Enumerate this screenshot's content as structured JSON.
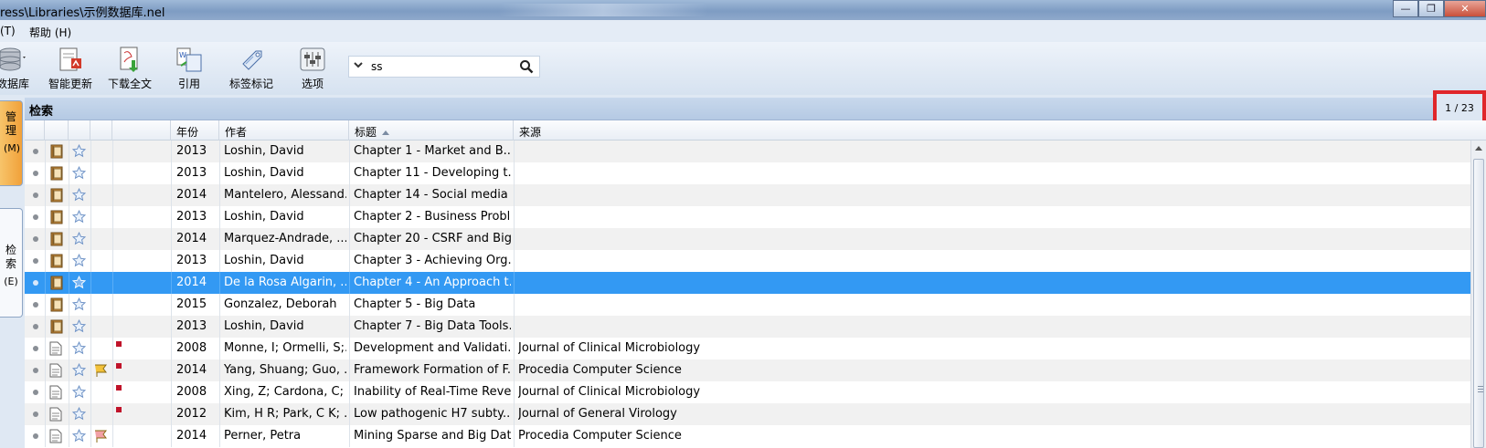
{
  "window": {
    "title": "ress\\Libraries\\示例数据库.nel",
    "buttons": {
      "minimize": "—",
      "maximize": "❐",
      "close": "✕"
    }
  },
  "menu": {
    "items": [
      "(T)",
      "帮助 (H)"
    ]
  },
  "toolbar": {
    "items": [
      {
        "label": "数据库",
        "icon": "database-icon"
      },
      {
        "label": "智能更新",
        "icon": "smart-update-icon"
      },
      {
        "label": "下载全文",
        "icon": "download-fulltext-icon"
      },
      {
        "label": "引用",
        "icon": "cite-icon"
      },
      {
        "label": "标签标记",
        "icon": "tag-icon"
      },
      {
        "label": "选项",
        "icon": "options-icon"
      }
    ],
    "search": {
      "value": "ss"
    }
  },
  "sidebar": {
    "tabs": [
      {
        "label": "管理",
        "shortcut": "(M)",
        "active": true
      },
      {
        "label": "检索",
        "shortcut": "(E)",
        "active": false
      }
    ]
  },
  "pane": {
    "title": "检索",
    "page_indicator": "1 / 23"
  },
  "table": {
    "columns": {
      "year": "年份",
      "author": "作者",
      "title": "标题",
      "source": "来源"
    },
    "sorted_by": "标题",
    "rows": [
      {
        "kind": "book",
        "flag": "",
        "marker": false,
        "year": "2013",
        "author": "Loshin, David",
        "title": "Chapter 1 - Market and B...",
        "source": ""
      },
      {
        "kind": "book",
        "flag": "",
        "marker": false,
        "year": "2013",
        "author": "Loshin, David",
        "title": "Chapter 11 - Developing t...",
        "source": ""
      },
      {
        "kind": "book",
        "flag": "",
        "marker": false,
        "year": "2014",
        "author": "Mantelero, Alessand...",
        "title": "Chapter 14 - Social media ...",
        "source": ""
      },
      {
        "kind": "book",
        "flag": "",
        "marker": false,
        "year": "2013",
        "author": "Loshin, David",
        "title": "Chapter 2 - Business Probl...",
        "source": ""
      },
      {
        "kind": "book",
        "flag": "",
        "marker": false,
        "year": "2014",
        "author": "Marquez-Andrade, ...",
        "title": "Chapter 20 - CSRF and Big...",
        "source": ""
      },
      {
        "kind": "book",
        "flag": "",
        "marker": false,
        "year": "2013",
        "author": "Loshin, David",
        "title": "Chapter 3 - Achieving Org...",
        "source": ""
      },
      {
        "kind": "book",
        "flag": "",
        "marker": false,
        "year": "2014",
        "author": "De la Rosa Algarin, ...",
        "title": "Chapter 4 - An Approach t...",
        "source": "",
        "selected": true
      },
      {
        "kind": "book",
        "flag": "",
        "marker": false,
        "year": "2015",
        "author": "Gonzalez, Deborah",
        "title": "Chapter 5 - Big Data",
        "source": ""
      },
      {
        "kind": "book",
        "flag": "",
        "marker": false,
        "year": "2013",
        "author": "Loshin, David",
        "title": "Chapter 7 - Big Data Tools...",
        "source": ""
      },
      {
        "kind": "doc",
        "flag": "",
        "marker": true,
        "year": "2008",
        "author": "Monne, I; Ormelli, S;...",
        "title": "Development and Validati...",
        "source": "Journal of Clinical Microbiology"
      },
      {
        "kind": "doc",
        "flag": "yellow",
        "marker": true,
        "year": "2014",
        "author": "Yang, Shuang; Guo, ...",
        "title": "Framework Formation of F...",
        "source": "Procedia Computer Science"
      },
      {
        "kind": "doc",
        "flag": "",
        "marker": true,
        "year": "2008",
        "author": "Xing, Z; Cardona, C; ...",
        "title": "Inability of Real-Time Reve...",
        "source": "Journal of Clinical Microbiology"
      },
      {
        "kind": "doc",
        "flag": "",
        "marker": true,
        "year": "2012",
        "author": "Kim, H R; Park, C K; ...",
        "title": "Low pathogenic H7 subty...",
        "source": "Journal of General Virology"
      },
      {
        "kind": "doc",
        "flag": "red",
        "marker": false,
        "year": "2014",
        "author": "Perner, Petra",
        "title": "Mining Sparse and Big Dat...",
        "source": "Procedia Computer Science"
      }
    ]
  },
  "colors": {
    "selection": "#3399f3",
    "highlight_box": "#e0262a",
    "active_tab": "#f1a13a",
    "marker": "#c0132a"
  }
}
